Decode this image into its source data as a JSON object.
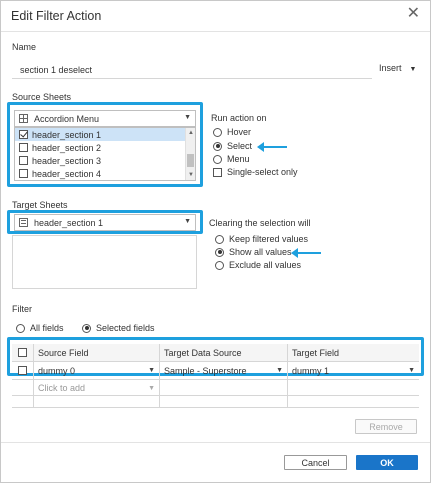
{
  "dialog": {
    "title": "Edit Filter Action"
  },
  "name_section": {
    "label": "Name",
    "value": "section 1 deselect",
    "insert_label": "Insert"
  },
  "source_sheets": {
    "label": "Source Sheets",
    "dashboard": "Accordion Menu",
    "items": [
      {
        "label": "header_section 1",
        "checked": true,
        "selected": true
      },
      {
        "label": "header_section 2",
        "checked": false
      },
      {
        "label": "header_section 3",
        "checked": false
      },
      {
        "label": "header_section 4",
        "checked": false
      }
    ]
  },
  "run_action": {
    "label": "Run action on",
    "options": [
      {
        "label": "Hover",
        "selected": false
      },
      {
        "label": "Select",
        "selected": true
      },
      {
        "label": "Menu",
        "selected": false
      }
    ],
    "single_select_label": "Single-select only"
  },
  "target_sheets": {
    "label": "Target Sheets",
    "sheet": "header_section 1"
  },
  "clearing": {
    "label": "Clearing the selection will",
    "options": [
      {
        "label": "Keep filtered values",
        "selected": false
      },
      {
        "label": "Show all values",
        "selected": true
      },
      {
        "label": "Exclude all values",
        "selected": false
      }
    ]
  },
  "filter": {
    "label": "Filter",
    "all_fields_label": "All fields",
    "selected_fields_label": "Selected fields",
    "columns": [
      "Source Field",
      "Target Data Source",
      "Target Field"
    ],
    "rows": [
      {
        "source_field": "dummy 0",
        "target_data_source": "Sample - Superstore",
        "target_field": "dummy 1"
      }
    ],
    "add_placeholder": "Click to add"
  },
  "buttons": {
    "remove": "Remove",
    "cancel": "Cancel",
    "ok": "OK"
  },
  "colors": {
    "highlight": "#1ea0de",
    "primary": "#1a75c9",
    "selection": "#cde3f7"
  }
}
